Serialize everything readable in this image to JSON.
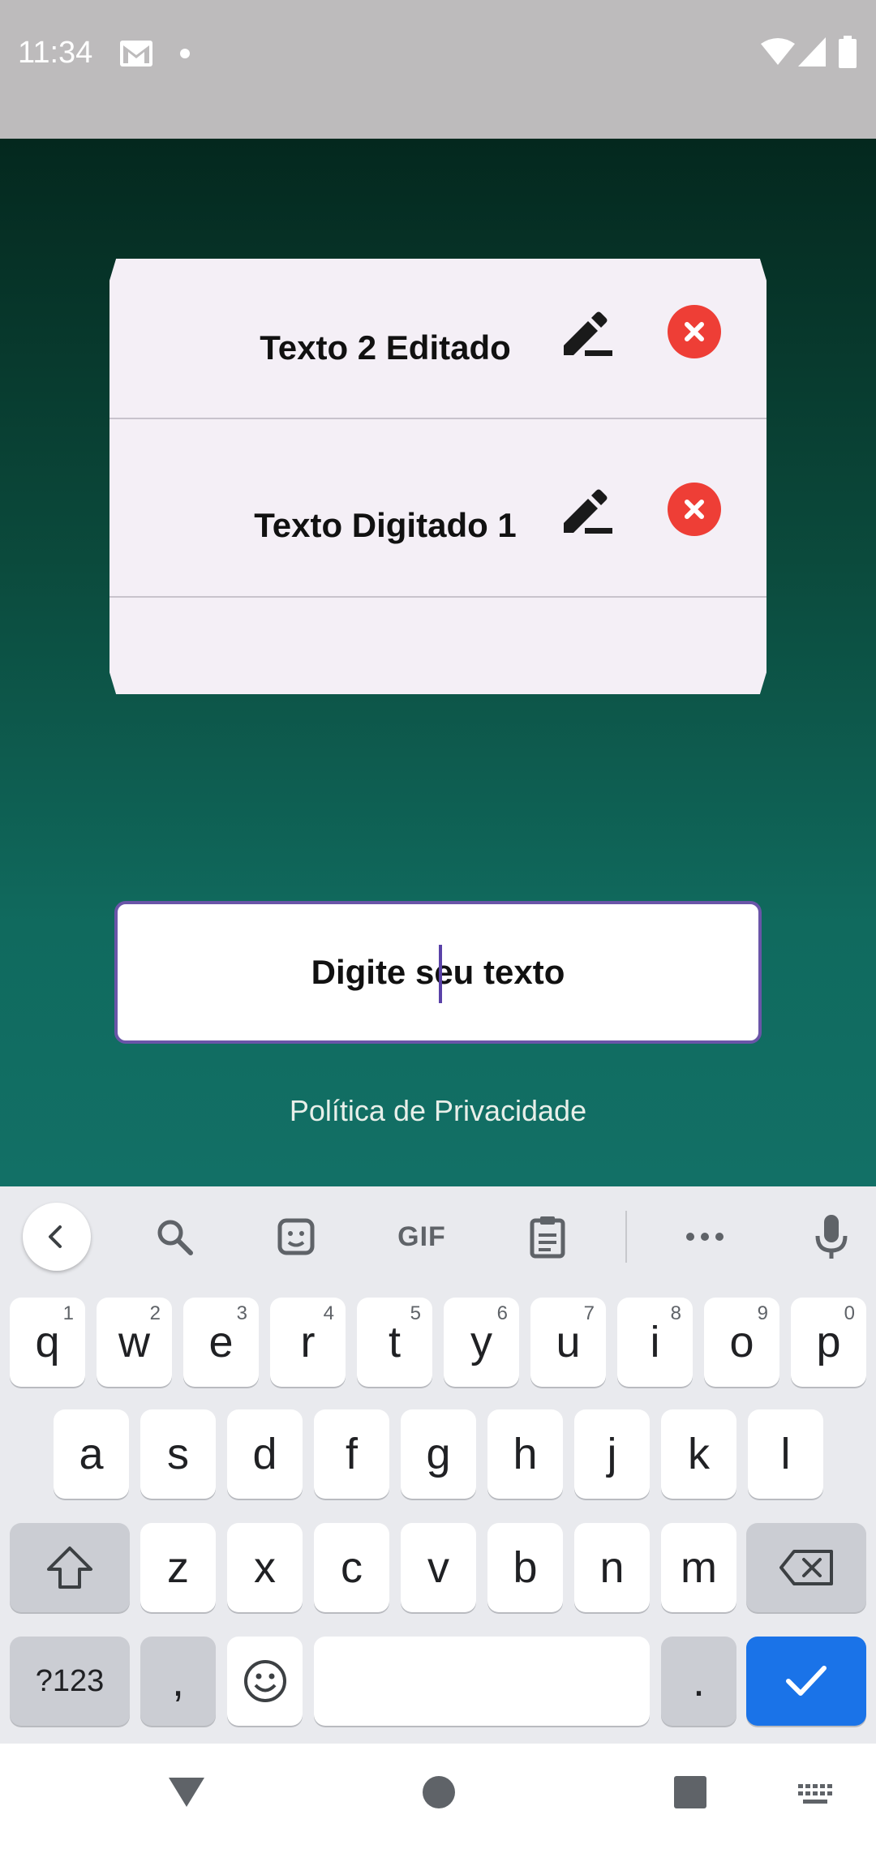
{
  "status_bar": {
    "time": "11:34",
    "icons": [
      "gmail-icon",
      "notification-dot-icon",
      "wifi-icon",
      "signal-icon",
      "battery-icon"
    ]
  },
  "list": {
    "items": [
      {
        "text": "Texto 2 Editado"
      },
      {
        "text": "Texto Digitado 1"
      }
    ],
    "edit_icon": "pencil-icon",
    "delete_icon": "close-circle-icon",
    "delete_color": "#ee3e36"
  },
  "input": {
    "value": "Digite seu texto",
    "border_color": "#6a55a8"
  },
  "footer": {
    "privacy_link": "Política de Privacidade"
  },
  "keyboard": {
    "toolbar": [
      "chevron-left-icon",
      "search-icon",
      "sticker-icon",
      "gif-icon",
      "clipboard-icon",
      "more-icon",
      "mic-icon"
    ],
    "gif_label": "GIF",
    "row1": [
      {
        "k": "q",
        "h": "1"
      },
      {
        "k": "w",
        "h": "2"
      },
      {
        "k": "e",
        "h": "3"
      },
      {
        "k": "r",
        "h": "4"
      },
      {
        "k": "t",
        "h": "5"
      },
      {
        "k": "y",
        "h": "6"
      },
      {
        "k": "u",
        "h": "7"
      },
      {
        "k": "i",
        "h": "8"
      },
      {
        "k": "o",
        "h": "9"
      },
      {
        "k": "p",
        "h": "0"
      }
    ],
    "row2": [
      "a",
      "s",
      "d",
      "f",
      "g",
      "h",
      "j",
      "k",
      "l"
    ],
    "row3": [
      "z",
      "x",
      "c",
      "v",
      "b",
      "n",
      "m"
    ],
    "symbols_label": "?123",
    "comma": ",",
    "period": ".",
    "enter_color": "#1a73e8"
  },
  "nav_bar": {
    "buttons": [
      "back-triangle-icon",
      "home-circle-icon",
      "recents-square-icon",
      "keyboard-switch-icon"
    ]
  }
}
